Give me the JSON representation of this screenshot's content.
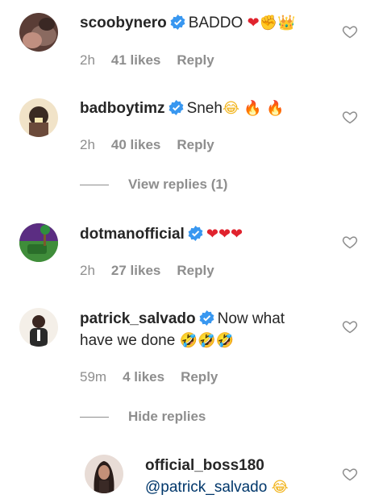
{
  "comments": [
    {
      "username": "scoobynero",
      "text": "BADDO ",
      "emojis": [
        "❤",
        "✊",
        "👑"
      ],
      "time": "2h",
      "likes": "41 likes",
      "reply": "Reply",
      "avatar_icon": "avatar-photo"
    },
    {
      "username": "badboytimz",
      "text": "Sneh",
      "emojis": [
        "😂",
        "🔥",
        "🔥"
      ],
      "time": "2h",
      "likes": "40 likes",
      "reply": "Reply",
      "avatar_icon": "avatar-photo"
    },
    {
      "username": "dotmanofficial",
      "text": "",
      "emojis": [
        "❤",
        "❤",
        "❤"
      ],
      "time": "2h",
      "likes": "27 likes",
      "reply": "Reply",
      "avatar_icon": "avatar-photo"
    },
    {
      "username": "patrick_salvado",
      "text": "Now what",
      "text2": "have we done ",
      "emojis": [
        "🤣",
        "🤣",
        "🤣"
      ],
      "time": "59m",
      "likes": "4 likes",
      "reply": "Reply",
      "avatar_icon": "avatar-photo"
    }
  ],
  "view_replies": "View replies (1)",
  "hide_replies": "Hide replies",
  "reply_comment": {
    "username": "official_boss180",
    "mention": "@patrick_salvado ",
    "emoji": "😂",
    "avatar_icon": "avatar-photo"
  },
  "colors": {
    "verified": "#3897f0",
    "meta": "#8e8e8e",
    "text": "#262626"
  }
}
